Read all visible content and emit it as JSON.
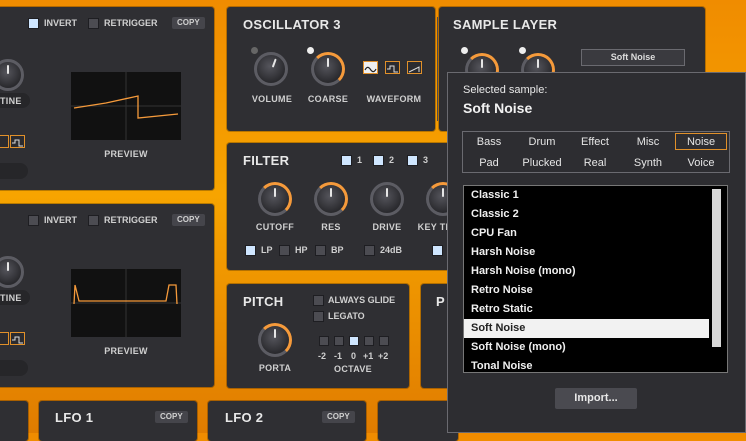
{
  "top_left": {
    "invert": "INVERT",
    "retrigger": "RETRIGGER",
    "copy": "COPY",
    "knob_label": "TINE",
    "preview": "PREVIEW"
  },
  "mid_left": {
    "invert": "INVERT",
    "retrigger": "RETRIGGER",
    "copy": "COPY",
    "knob_label": "TINE",
    "preview": "PREVIEW"
  },
  "osc3": {
    "title": "OSCILLATOR 3",
    "volume": "VOLUME",
    "coarse": "COARSE",
    "waveform": "WAVEFORM",
    "waveforms": [
      "sine-wave-icon",
      "square-wave-icon",
      "saw-wave-icon"
    ],
    "selected_waveform": 0
  },
  "sample_layer": {
    "title": "SAMPLE LAYER",
    "sample_name": "Soft Noise"
  },
  "filter": {
    "title": "FILTER",
    "tabs": [
      "1",
      "2",
      "3"
    ],
    "cutoff": "CUTOFF",
    "res": "RES",
    "drive": "DRIVE",
    "key_track": "KEY TR",
    "modes": [
      "LP",
      "HP",
      "BP"
    ],
    "slope": "24dB"
  },
  "pitch": {
    "title": "PITCH",
    "always_glide": "ALWAYS GLIDE",
    "legato": "LEGATO",
    "porta": "PORTA",
    "octave": "OCTAVE",
    "octave_values": [
      "-2",
      "-1",
      "0",
      "+1",
      "+2"
    ],
    "octave_selected": 2
  },
  "pitch_cut": "P",
  "bottom": {
    "lfo1": "LFO 1",
    "lfo2": "LFO 2",
    "copy": "COPY"
  },
  "popup": {
    "selected_label": "Selected sample:",
    "selected_value": "Soft Noise",
    "categories_row1": [
      "Bass",
      "Drum",
      "Effect",
      "Misc",
      "Noise"
    ],
    "categories_row2": [
      "Pad",
      "Plucked",
      "Real",
      "Synth",
      "Voice"
    ],
    "selected_category": "Noise",
    "samples": [
      "Classic 1",
      "Classic 2",
      "CPU Fan",
      "Harsh Noise",
      "Harsh Noise (mono)",
      "Retro Noise",
      "Retro Static",
      "Soft Noise",
      "Soft Noise (mono)",
      "Tonal Noise"
    ],
    "selected_sample_index": 7,
    "import_label": "Import..."
  },
  "colors": {
    "accent": "#f59a3b",
    "panel": "#2f2f33",
    "background_top": "#f08c00"
  }
}
